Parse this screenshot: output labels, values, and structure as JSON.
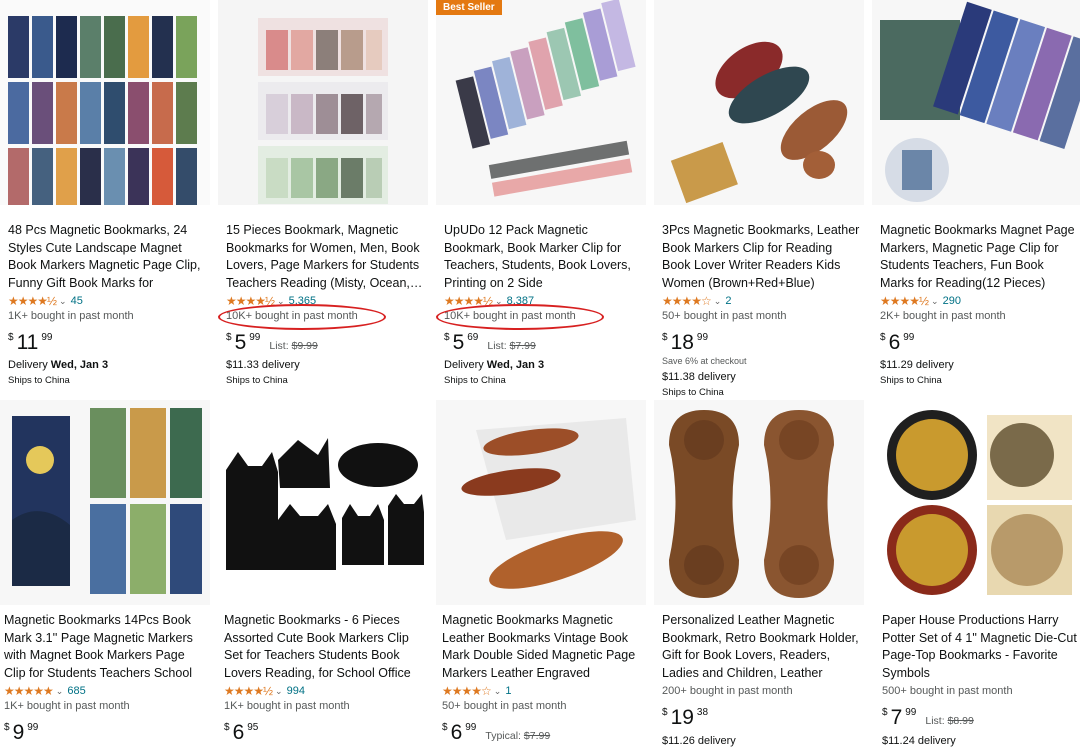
{
  "products": [
    {
      "title": "48 Pcs Magnetic Bookmarks, 24 Styles Cute Landscape Magnet Book Markers Magnetic Page Clip, Funny Gift Book Marks for Students…",
      "stars": "★★★★½",
      "rating_count": "45",
      "bought": "1K+ bought in past month",
      "price_cur": "$",
      "price_whole": "11",
      "price_frac": "99",
      "delivery_label": "Delivery",
      "delivery_date": "Wed, Jan 3",
      "ships": "Ships to China"
    },
    {
      "title": "15 Pieces Bookmark, Magnetic Bookmarks for Women, Men, Book Lovers, Page Markers for Students Teachers Reading (Misty, Ocean,…",
      "stars": "★★★★½",
      "rating_count": "5,365",
      "bought": "10K+ bought in past month",
      "price_cur": "$",
      "price_whole": "5",
      "price_frac": "99",
      "list_label": "List:",
      "list_price": "$9.99",
      "delivery_text": "$11.33 delivery",
      "ships": "Ships to China"
    },
    {
      "badge": "Best Seller",
      "title": "UpUDo 12 Pack Magnetic Bookmark, Book Marker Clip for Teachers, Students, Book Lovers, Printing on 2 Side",
      "stars": "★★★★½",
      "rating_count": "8,387",
      "bought": "10K+ bought in past month",
      "price_cur": "$",
      "price_whole": "5",
      "price_frac": "69",
      "list_label": "List:",
      "list_price": "$7.99",
      "delivery_label": "Delivery",
      "delivery_date": "Wed, Jan 3",
      "ships": "Ships to China"
    },
    {
      "title": "3Pcs Magnetic Bookmarks, Leather Book Markers Clip for Reading Book Lover Writer Readers Kids Women (Brown+Red+Blue)",
      "stars": "★★★★☆",
      "rating_count": "2",
      "bought": "50+ bought in past month",
      "price_cur": "$",
      "price_whole": "18",
      "price_frac": "99",
      "save_text": "Save 6% at checkout",
      "delivery_text": "$11.38 delivery",
      "ships": "Ships to China"
    },
    {
      "title": "Magnetic Bookmarks Magnet Page Markers, Magnetic Page Clip for Students Teachers, Fun Book Marks for Reading(12 Pieces)",
      "stars": "★★★★½",
      "rating_count": "290",
      "bought": "2K+ bought in past month",
      "price_cur": "$",
      "price_whole": "6",
      "price_frac": "99",
      "delivery_text": "$11.29 delivery",
      "ships": "Ships to China"
    },
    {
      "title": "Magnetic Bookmarks 14Pcs Book Mark 3.1'' Page Magnetic Markers with Magnet Book Markers Page Clip for Students Teachers School Home…",
      "stars": "★★★★★",
      "rating_count": "685",
      "bought": "1K+ bought in past month",
      "price_cur": "$",
      "price_whole": "9",
      "price_frac": "99"
    },
    {
      "title": "Magnetic Bookmarks - 6 Pieces Assorted Cute Book Markers Clip Set for Teachers Students Book Lovers Reading, for School Office Home…",
      "stars": "★★★★½",
      "rating_count": "994",
      "bought": "1K+ bought in past month",
      "price_cur": "$",
      "price_whole": "6",
      "price_frac": "95"
    },
    {
      "title": "Magnetic Bookmarks Magnetic Leather Bookmarks Vintage Book Mark Double Sided Magnetic Page Markers Leather Engraved Bookmar…",
      "stars": "★★★★☆",
      "rating_count": "1",
      "bought": "50+ bought in past month",
      "price_cur": "$",
      "price_whole": "6",
      "price_frac": "99",
      "typical_label": "Typical:",
      "typical_price": "$7.99"
    },
    {
      "title": "Personalized Leather Magnetic Bookmark, Retro Bookmark Holder, Gift for Book Lovers, Readers, Ladies and Children, Leather Magnetic…",
      "bought": "200+ bought in past month",
      "price_cur": "$",
      "price_whole": "19",
      "price_frac": "38",
      "delivery_text": "$11.26 delivery"
    },
    {
      "title": "Paper House Productions Harry Potter Set of 4 1\" Magnetic Die-Cut Page-Top Bookmarks - Favorite Symbols",
      "bought": "500+ bought in past month",
      "price_cur": "$",
      "price_whole": "7",
      "price_frac": "99",
      "list_label": "List:",
      "list_price": "$8.99",
      "delivery_text": "$11.24 delivery"
    }
  ],
  "colors": {
    "star": "#de7921",
    "link": "#007185",
    "badge": "#e47911",
    "annotation": "#d72020"
  }
}
